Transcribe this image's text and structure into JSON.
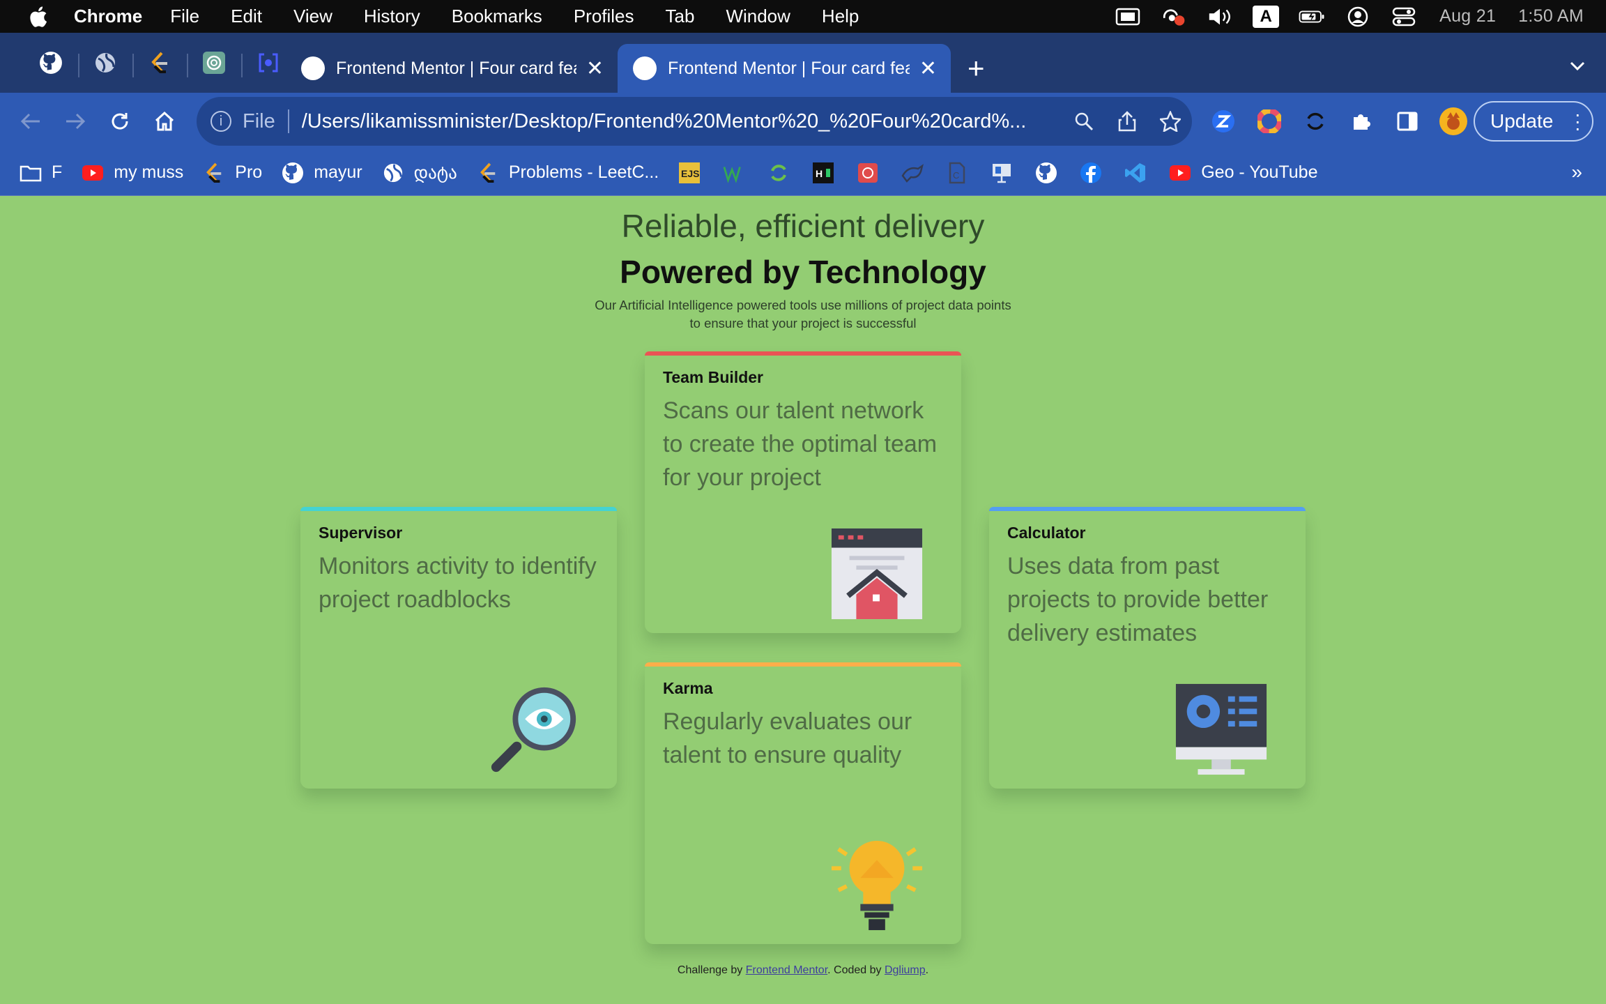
{
  "menubar": {
    "app_name": "Chrome",
    "items": [
      "File",
      "Edit",
      "View",
      "History",
      "Bookmarks",
      "Profiles",
      "Tab",
      "Window",
      "Help"
    ],
    "input_indicator": "A",
    "date": "Aug 21",
    "time": "1:50 AM"
  },
  "tabs": {
    "inactive_title": "Frontend Mentor | Four card fea",
    "active_title": "Frontend Mentor | Four card fea",
    "new_tab": "+"
  },
  "toolbar": {
    "scheme_label": "File",
    "url": "/Users/likamissminister/Desktop/Frontend%20Mentor%20_%20Four%20card%...",
    "update_label": "Update"
  },
  "bookmarks": {
    "items": [
      "F",
      "my muss",
      "Pro",
      "mayur",
      "დატა",
      "Problems - LeetC...",
      "Geo - YouTube"
    ],
    "more": "»"
  },
  "page": {
    "heading_light": "Reliable, efficient delivery",
    "heading_bold": "Powered by Technology",
    "intro": "Our Artificial Intelligence powered tools use millions of project data points to ensure that your project is successful",
    "cards": [
      {
        "title": "Supervisor",
        "desc": "Monitors activity to identify project roadblocks",
        "accent": "#44d3d2",
        "icon": "magnifier-eye-icon"
      },
      {
        "title": "Team Builder",
        "desc": "Scans our talent network to create the optimal team for your project",
        "accent": "#ea5454",
        "icon": "browser-house-icon"
      },
      {
        "title": "Karma",
        "desc": "Regularly evaluates our talent to ensure quality",
        "accent": "#fcae4a",
        "icon": "lightbulb-icon"
      },
      {
        "title": "Calculator",
        "desc": "Uses data from past projects to provide better delivery estimates",
        "accent": "#549ef2",
        "icon": "monitor-icon"
      }
    ],
    "footer": {
      "prefix": "Challenge by ",
      "link1": "Frontend Mentor",
      "middle": ". Coded by ",
      "link2": "Dgliump",
      "suffix": "."
    }
  },
  "colors": {
    "page_bg": "#93cd73",
    "toolbar_bg": "#2e5ab4",
    "tabstrip_bg": "#213a6f"
  }
}
